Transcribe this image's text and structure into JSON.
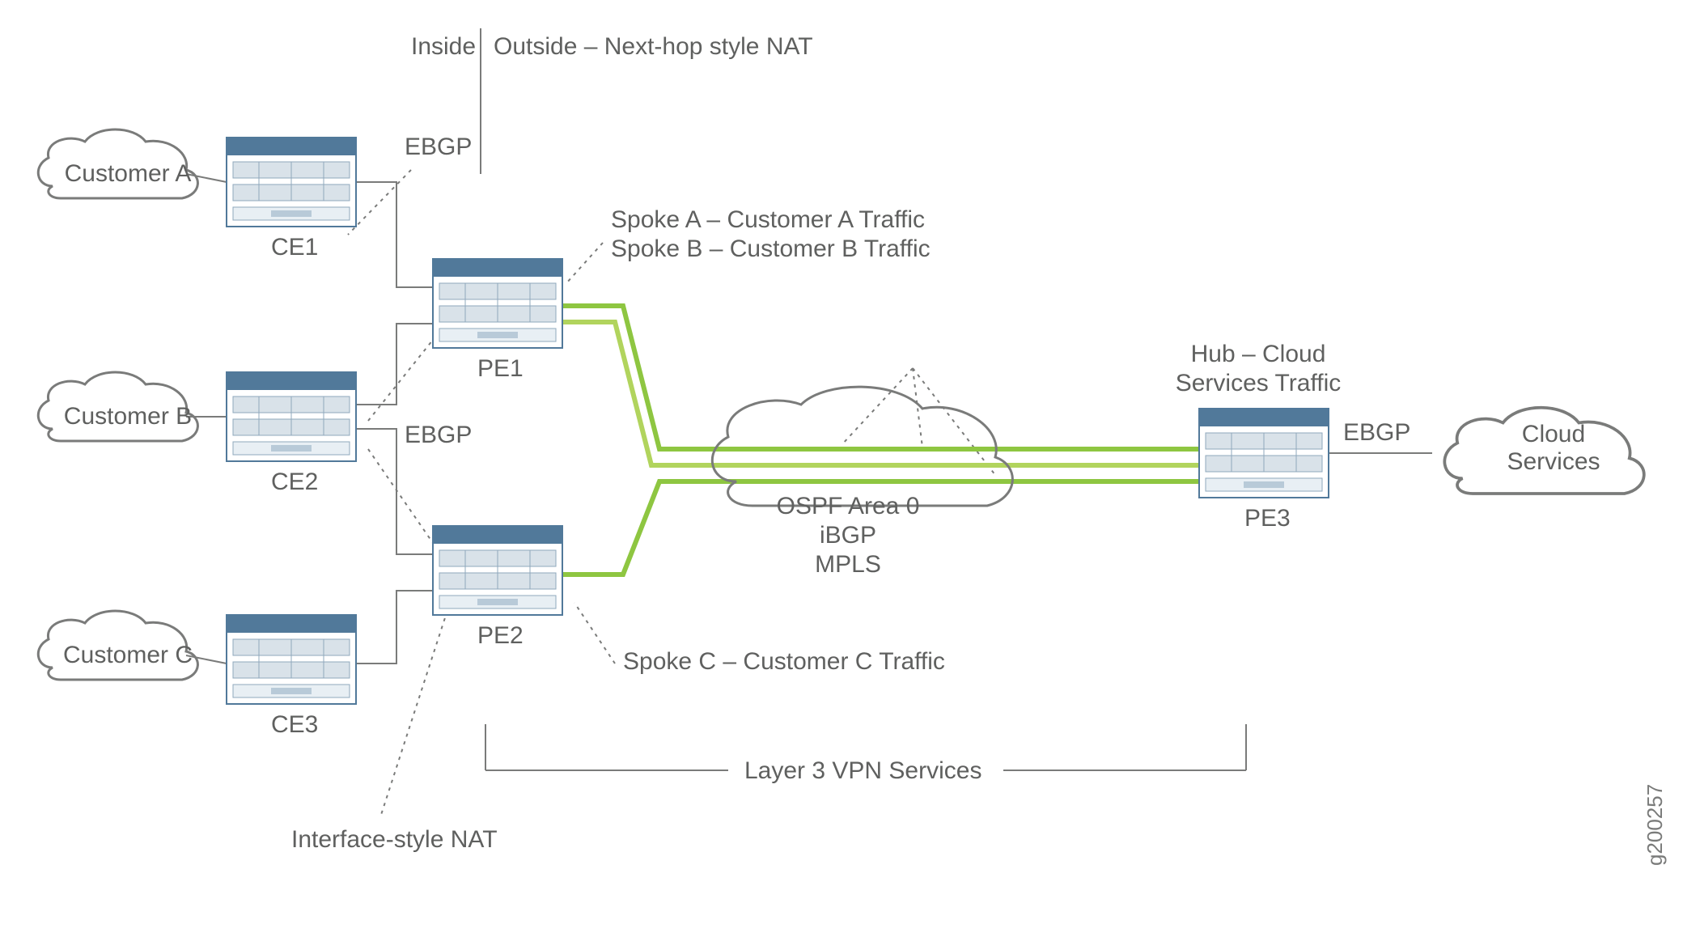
{
  "labels": {
    "inside": "Inside",
    "outside": "Outside – Next-hop style NAT",
    "ebgp1": "EBGP",
    "ebgp2": "EBGP",
    "ebgp3": "EBGP",
    "spokeAB": "Spoke A – Customer A Traffic\nSpoke B – Customer B Traffic",
    "spokeC": "Spoke C – Customer C Traffic",
    "hub": "Hub – Cloud\nServices Traffic",
    "ospf": "OSPF Area 0\niBGP\nMPLS",
    "l3vpn": "Layer 3 VPN Services",
    "ifnat": "Interface-style NAT",
    "figid": "g200257"
  },
  "clouds": {
    "custA": "Customer A",
    "custB": "Customer B",
    "custC": "Customer C",
    "cloud": "Cloud\nServices"
  },
  "devices": {
    "ce1": "CE1",
    "ce2": "CE2",
    "ce3": "CE3",
    "pe1": "PE1",
    "pe2": "PE2",
    "pe3": "PE3"
  }
}
